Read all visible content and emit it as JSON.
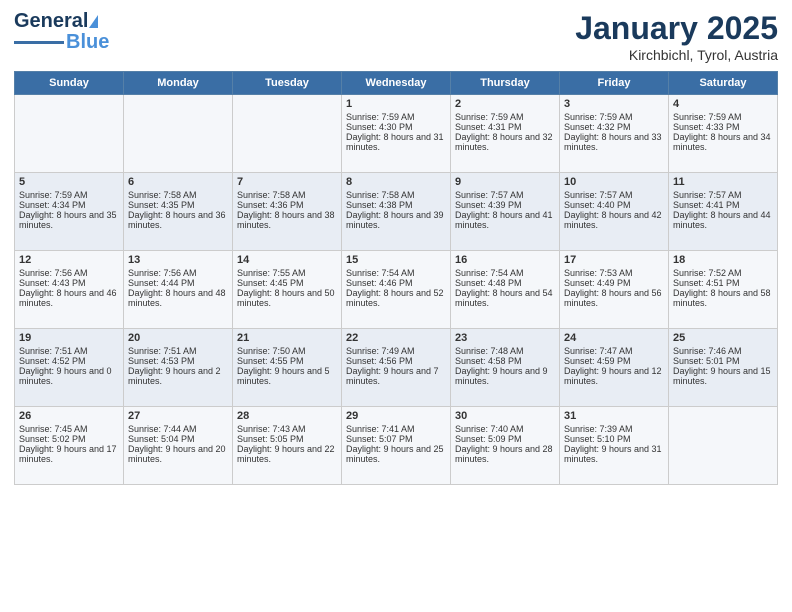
{
  "header": {
    "logo_general": "General",
    "logo_blue": "Blue",
    "month_title": "January 2025",
    "location": "Kirchbichl, Tyrol, Austria"
  },
  "days_of_week": [
    "Sunday",
    "Monday",
    "Tuesday",
    "Wednesday",
    "Thursday",
    "Friday",
    "Saturday"
  ],
  "weeks": [
    [
      {
        "day": "",
        "content": ""
      },
      {
        "day": "",
        "content": ""
      },
      {
        "day": "",
        "content": ""
      },
      {
        "day": "1",
        "content": "Sunrise: 7:59 AM\nSunset: 4:30 PM\nDaylight: 8 hours and 31 minutes."
      },
      {
        "day": "2",
        "content": "Sunrise: 7:59 AM\nSunset: 4:31 PM\nDaylight: 8 hours and 32 minutes."
      },
      {
        "day": "3",
        "content": "Sunrise: 7:59 AM\nSunset: 4:32 PM\nDaylight: 8 hours and 33 minutes."
      },
      {
        "day": "4",
        "content": "Sunrise: 7:59 AM\nSunset: 4:33 PM\nDaylight: 8 hours and 34 minutes."
      }
    ],
    [
      {
        "day": "5",
        "content": "Sunrise: 7:59 AM\nSunset: 4:34 PM\nDaylight: 8 hours and 35 minutes."
      },
      {
        "day": "6",
        "content": "Sunrise: 7:58 AM\nSunset: 4:35 PM\nDaylight: 8 hours and 36 minutes."
      },
      {
        "day": "7",
        "content": "Sunrise: 7:58 AM\nSunset: 4:36 PM\nDaylight: 8 hours and 38 minutes."
      },
      {
        "day": "8",
        "content": "Sunrise: 7:58 AM\nSunset: 4:38 PM\nDaylight: 8 hours and 39 minutes."
      },
      {
        "day": "9",
        "content": "Sunrise: 7:57 AM\nSunset: 4:39 PM\nDaylight: 8 hours and 41 minutes."
      },
      {
        "day": "10",
        "content": "Sunrise: 7:57 AM\nSunset: 4:40 PM\nDaylight: 8 hours and 42 minutes."
      },
      {
        "day": "11",
        "content": "Sunrise: 7:57 AM\nSunset: 4:41 PM\nDaylight: 8 hours and 44 minutes."
      }
    ],
    [
      {
        "day": "12",
        "content": "Sunrise: 7:56 AM\nSunset: 4:43 PM\nDaylight: 8 hours and 46 minutes."
      },
      {
        "day": "13",
        "content": "Sunrise: 7:56 AM\nSunset: 4:44 PM\nDaylight: 8 hours and 48 minutes."
      },
      {
        "day": "14",
        "content": "Sunrise: 7:55 AM\nSunset: 4:45 PM\nDaylight: 8 hours and 50 minutes."
      },
      {
        "day": "15",
        "content": "Sunrise: 7:54 AM\nSunset: 4:46 PM\nDaylight: 8 hours and 52 minutes."
      },
      {
        "day": "16",
        "content": "Sunrise: 7:54 AM\nSunset: 4:48 PM\nDaylight: 8 hours and 54 minutes."
      },
      {
        "day": "17",
        "content": "Sunrise: 7:53 AM\nSunset: 4:49 PM\nDaylight: 8 hours and 56 minutes."
      },
      {
        "day": "18",
        "content": "Sunrise: 7:52 AM\nSunset: 4:51 PM\nDaylight: 8 hours and 58 minutes."
      }
    ],
    [
      {
        "day": "19",
        "content": "Sunrise: 7:51 AM\nSunset: 4:52 PM\nDaylight: 9 hours and 0 minutes."
      },
      {
        "day": "20",
        "content": "Sunrise: 7:51 AM\nSunset: 4:53 PM\nDaylight: 9 hours and 2 minutes."
      },
      {
        "day": "21",
        "content": "Sunrise: 7:50 AM\nSunset: 4:55 PM\nDaylight: 9 hours and 5 minutes."
      },
      {
        "day": "22",
        "content": "Sunrise: 7:49 AM\nSunset: 4:56 PM\nDaylight: 9 hours and 7 minutes."
      },
      {
        "day": "23",
        "content": "Sunrise: 7:48 AM\nSunset: 4:58 PM\nDaylight: 9 hours and 9 minutes."
      },
      {
        "day": "24",
        "content": "Sunrise: 7:47 AM\nSunset: 4:59 PM\nDaylight: 9 hours and 12 minutes."
      },
      {
        "day": "25",
        "content": "Sunrise: 7:46 AM\nSunset: 5:01 PM\nDaylight: 9 hours and 15 minutes."
      }
    ],
    [
      {
        "day": "26",
        "content": "Sunrise: 7:45 AM\nSunset: 5:02 PM\nDaylight: 9 hours and 17 minutes."
      },
      {
        "day": "27",
        "content": "Sunrise: 7:44 AM\nSunset: 5:04 PM\nDaylight: 9 hours and 20 minutes."
      },
      {
        "day": "28",
        "content": "Sunrise: 7:43 AM\nSunset: 5:05 PM\nDaylight: 9 hours and 22 minutes."
      },
      {
        "day": "29",
        "content": "Sunrise: 7:41 AM\nSunset: 5:07 PM\nDaylight: 9 hours and 25 minutes."
      },
      {
        "day": "30",
        "content": "Sunrise: 7:40 AM\nSunset: 5:09 PM\nDaylight: 9 hours and 28 minutes."
      },
      {
        "day": "31",
        "content": "Sunrise: 7:39 AM\nSunset: 5:10 PM\nDaylight: 9 hours and 31 minutes."
      },
      {
        "day": "",
        "content": ""
      }
    ]
  ]
}
